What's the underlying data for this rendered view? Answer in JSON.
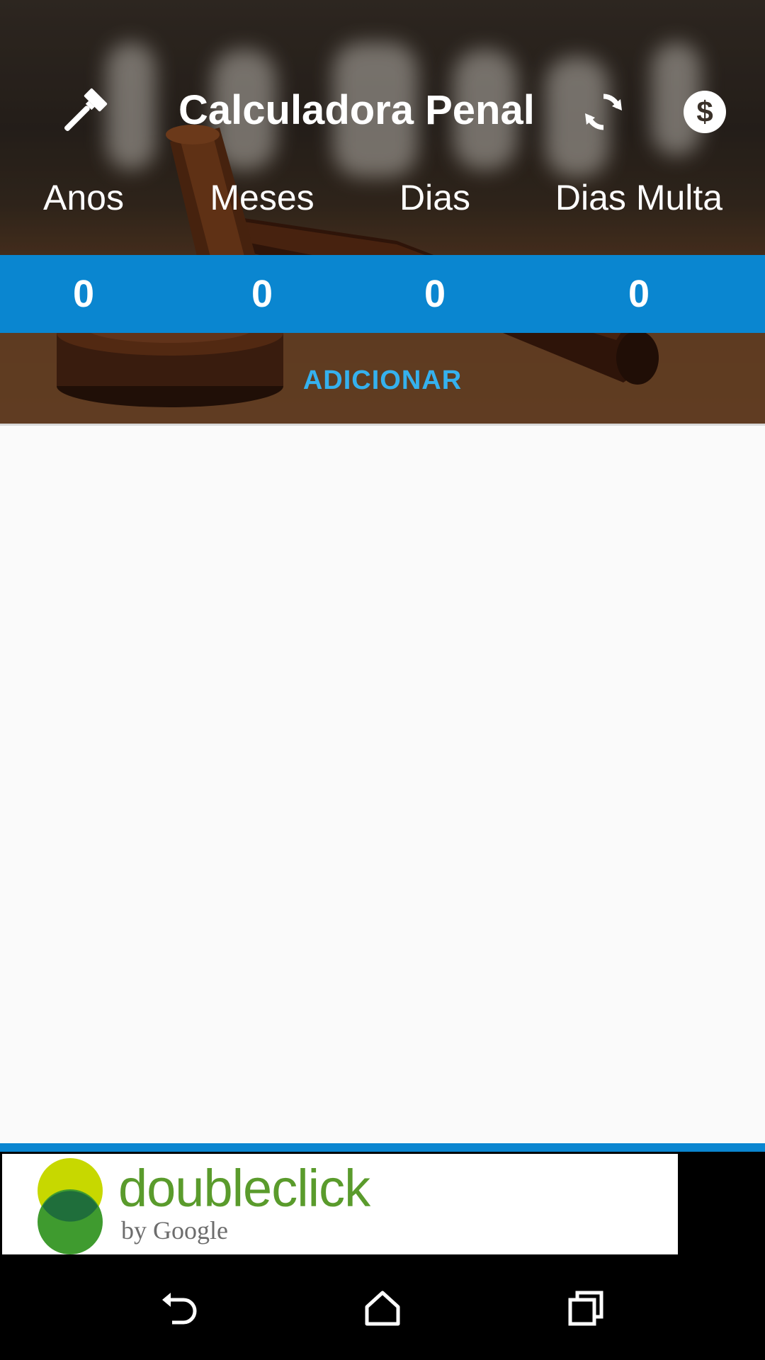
{
  "app": {
    "title": "Calculadora Penal"
  },
  "toolbar": {
    "left_icon": "gavel-icon",
    "refresh_icon": "refresh-icon",
    "money_icon": "dollar-circle-icon"
  },
  "columns": [
    {
      "label": "Anos",
      "value": "0"
    },
    {
      "label": "Meses",
      "value": "0"
    },
    {
      "label": "Dias",
      "value": "0"
    },
    {
      "label": "Dias Multa",
      "value": "0"
    }
  ],
  "actions": {
    "add_label": "ADICIONAR"
  },
  "ad": {
    "brand": "doubleclick",
    "sub": "by Google"
  },
  "navbar": {
    "back_icon": "back-icon",
    "home_icon": "home-icon",
    "recents_icon": "recents-icon"
  },
  "colors": {
    "accent_blue": "#0a86d0",
    "add_text": "#35b1ee",
    "content_bg": "#fafafa"
  }
}
